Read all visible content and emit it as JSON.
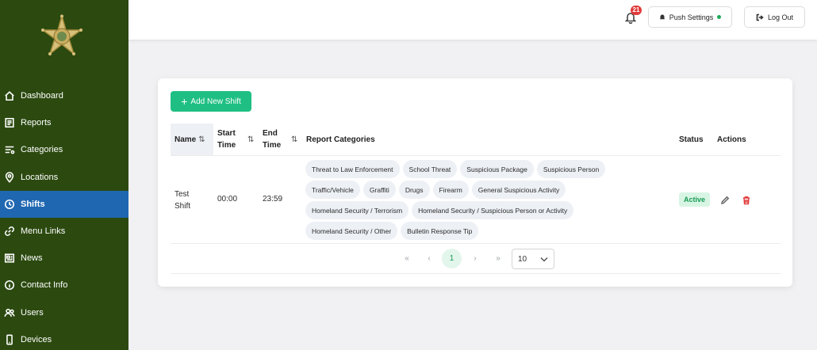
{
  "topbar": {
    "notification_count": "21",
    "push_settings_label": "Push Settings",
    "logout_label": "Log Out",
    "push_status_color": "#1faa59"
  },
  "sidebar": {
    "items": [
      {
        "label": "Dashboard",
        "icon": "home-icon"
      },
      {
        "label": "Reports",
        "icon": "reports-icon"
      },
      {
        "label": "Categories",
        "icon": "categories-icon"
      },
      {
        "label": "Locations",
        "icon": "location-pin-icon"
      },
      {
        "label": "Shifts",
        "icon": "clock-icon",
        "active": true
      },
      {
        "label": "Menu Links",
        "icon": "link-icon"
      },
      {
        "label": "News",
        "icon": "news-icon"
      },
      {
        "label": "Contact Info",
        "icon": "info-icon"
      },
      {
        "label": "Users",
        "icon": "users-icon"
      },
      {
        "label": "Devices",
        "icon": "device-icon"
      }
    ]
  },
  "main": {
    "add_button_label": "Add New Shift",
    "table": {
      "headers": {
        "name": "Name",
        "start_time": "Start Time",
        "end_time": "End Time",
        "report_categories": "Report Categories",
        "status": "Status",
        "actions": "Actions"
      },
      "rows": [
        {
          "name": "Test Shift",
          "start_time": "00:00",
          "end_time": "23:59",
          "categories": [
            "Threat to Law Enforcement",
            "School Threat",
            "Suspicious Package",
            "Suspicious Person",
            "Traffic/Vehicle",
            "Graffiti",
            "Drugs",
            "Firearm",
            "General Suspicious Activity",
            "Homeland Security / Terrorism",
            "Homeland Security / Suspicious Person or Activity",
            "Homeland Security / Other",
            "Bulletin Response Tip"
          ],
          "status": "Active"
        }
      ]
    },
    "pagination": {
      "first": "«",
      "prev": "‹",
      "current_page": "1",
      "next": "›",
      "last": "»",
      "rows_per_page": "10"
    }
  },
  "colors": {
    "sidebar_bg": "#2c4a10",
    "sidebar_active": "#1f67b1",
    "accent_green": "#1fbf83",
    "status_active": "#189a55",
    "delete_red": "#e23b3b"
  }
}
